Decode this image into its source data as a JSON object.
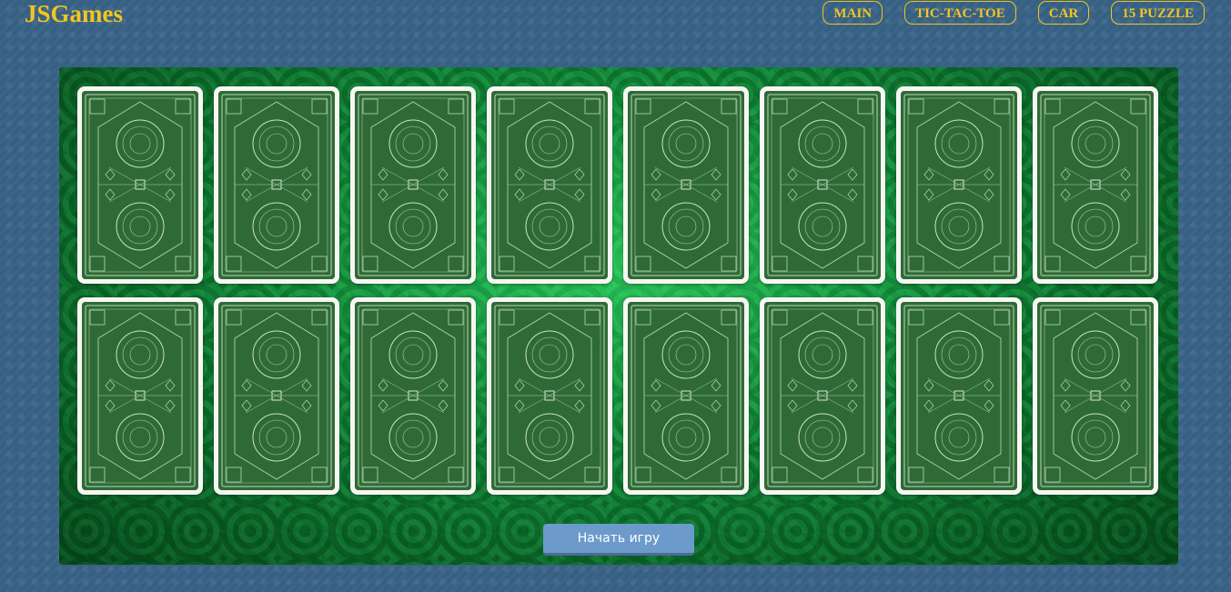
{
  "header": {
    "logo": "JSGames",
    "nav": [
      {
        "label": "MAIN"
      },
      {
        "label": "TIC-TAC-TOE"
      },
      {
        "label": "CAR"
      },
      {
        "label": "15 PUZZLE"
      }
    ]
  },
  "game": {
    "rows": 2,
    "columns": 8,
    "card_face": "back",
    "card_back_design": "green-ornamental-card-back",
    "start_button_label": "Начать игру"
  },
  "colors": {
    "page_background": "#3a6488",
    "accent": "#f2c61f",
    "table_felt": "#0e7a32",
    "card_back": "#2f6a36",
    "button": "#6c9acb"
  }
}
